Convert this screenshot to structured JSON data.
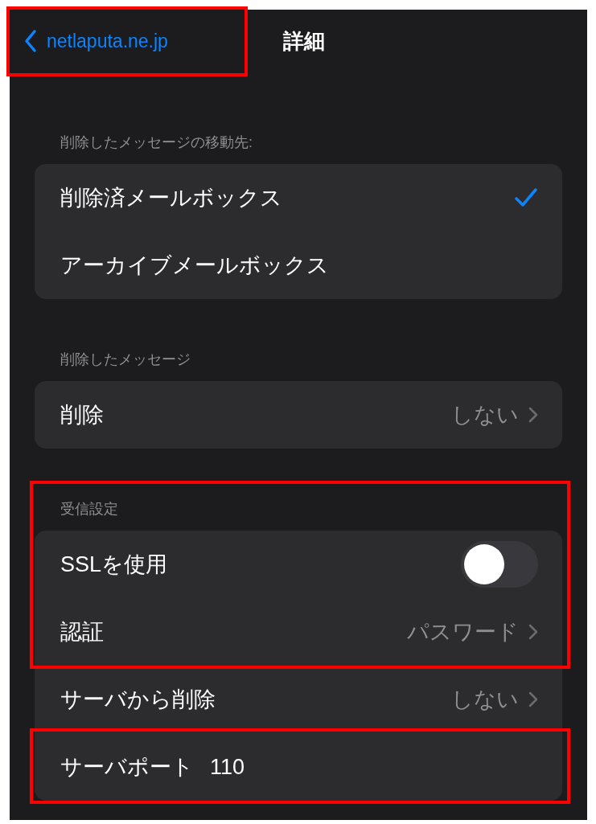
{
  "nav": {
    "back_label": "netlaputa.ne.jp",
    "back_highlighted": true,
    "title": "詳細"
  },
  "sections": [
    {
      "header": "削除したメッセージの移動先:",
      "header_highlighted": false,
      "rows": [
        {
          "kind": "check",
          "label": "削除済メールボックス",
          "selected": true,
          "highlighted": false
        },
        {
          "kind": "check",
          "label": "アーカイブメールボックス",
          "selected": false,
          "highlighted": false
        }
      ]
    },
    {
      "header": "削除したメッセージ",
      "header_highlighted": false,
      "rows": [
        {
          "kind": "value",
          "label": "削除",
          "value": "しない",
          "highlighted": false
        }
      ]
    },
    {
      "header": "受信設定",
      "header_highlighted": true,
      "rows": [
        {
          "kind": "toggle",
          "label": "SSLを使用",
          "on": false,
          "highlighted": true
        },
        {
          "kind": "value",
          "label": "認証",
          "value": "パスワード",
          "highlighted": true
        },
        {
          "kind": "value",
          "label": "サーバから削除",
          "value": "しない",
          "highlighted": false
        },
        {
          "kind": "field",
          "label": "サーバポート",
          "value": "110",
          "highlighted": true
        }
      ]
    }
  ]
}
